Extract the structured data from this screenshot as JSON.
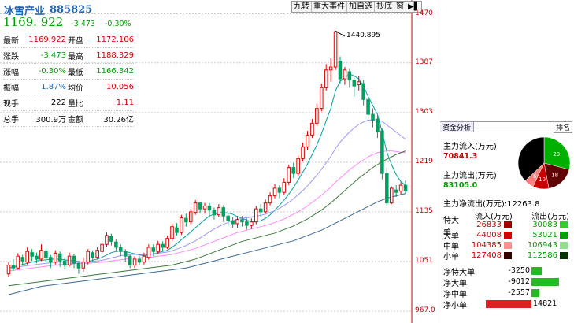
{
  "toolbar": [
    "九转",
    "重大事件",
    "加自选",
    "抄底",
    "窗",
    "▶▌"
  ],
  "y_ticks": [
    "1470",
    "1387",
    "1303",
    "1219",
    "1135",
    "1051",
    "967.0"
  ],
  "max_label": "1440.895",
  "header": {
    "name": "冰雪产业",
    "code": "885825",
    "price": "1169. 922",
    "change": "-3.473",
    "pct": "-0.30%"
  },
  "quote": [
    {
      "k": "最新",
      "v": "1169.922",
      "vc": "r",
      "k2": "开盘",
      "v2": "1172.106",
      "v2c": "r"
    },
    {
      "k": "涨跌",
      "v": "-3.473",
      "vc": "g",
      "k2": "最高",
      "v2": "1188.329",
      "v2c": "r"
    },
    {
      "k": "涨幅",
      "v": "-0.30%",
      "vc": "g",
      "k2": "最低",
      "v2": "1166.342",
      "v2c": "g"
    },
    {
      "k": "振幅",
      "v": "1.87%",
      "vc": "b",
      "k2": "均价",
      "v2": "10.056",
      "v2c": "r"
    },
    {
      "k": "现手",
      "v": "222",
      "vc": "",
      "k2": "量比",
      "v2": "1.11",
      "v2c": "r"
    },
    {
      "k": "总手",
      "v": "300.9万",
      "vc": "",
      "k2": "金额",
      "v2": "30.26亿",
      "v2c": ""
    }
  ],
  "capital": {
    "tab": "资金分析",
    "rank": "排名",
    "inflow_label": "主力流入(万元)",
    "inflow": "70841.3",
    "outflow_label": "主力流出(万元)",
    "outflow": "83105.0",
    "net_label": "主力净流出(万元):",
    "net": "12263.8",
    "pie": [
      {
        "label": "29",
        "value": 29
      },
      {
        "label": "18",
        "value": 18
      },
      {
        "label": "10",
        "value": 10
      },
      {
        "label": "6",
        "value": 6
      }
    ]
  },
  "flow_table": {
    "h_in": "流入(万元)",
    "h_out": "流出(万元)",
    "rows": [
      {
        "k": "特大单",
        "in": "26833",
        "out": "30083",
        "cin": "#a00000",
        "cout": "#33cc33"
      },
      {
        "k": "大单",
        "in": "44008",
        "out": "53021",
        "cin": "#d00000",
        "cout": "#00a000"
      },
      {
        "k": "中单",
        "in": "104385",
        "out": "106943",
        "cin": "#ff9090",
        "cout": "#90e090"
      },
      {
        "k": "小单",
        "in": "127408",
        "out": "112586",
        "cin": "#330000",
        "cout": "#003300"
      }
    ]
  },
  "net_flow": [
    {
      "k": "净特大单",
      "v": "-3250",
      "frac": -0.22
    },
    {
      "k": "净大单",
      "v": "-9012",
      "frac": -0.61
    },
    {
      "k": "净中单",
      "v": "-2557",
      "frac": -0.17
    },
    {
      "k": "净小单",
      "v": "14821",
      "frac": 1.0
    }
  ],
  "chart_data": {
    "type": "candlestick",
    "ylim": [
      967.0,
      1480
    ],
    "y_ticks": [
      1470,
      1387,
      1303,
      1219,
      1135,
      1051,
      967.0
    ],
    "max_annotation": 1440.895,
    "candles": [
      [
        1030,
        1045,
        1025,
        1050
      ],
      [
        1045,
        1040,
        1035,
        1055
      ],
      [
        1040,
        1060,
        1038,
        1065
      ],
      [
        1058,
        1052,
        1045,
        1062
      ],
      [
        1050,
        1068,
        1046,
        1075
      ],
      [
        1066,
        1060,
        1052,
        1072
      ],
      [
        1060,
        1055,
        1048,
        1066
      ],
      [
        1055,
        1070,
        1052,
        1080
      ],
      [
        1068,
        1058,
        1050,
        1072
      ],
      [
        1058,
        1050,
        1040,
        1062
      ],
      [
        1050,
        1065,
        1046,
        1070
      ],
      [
        1064,
        1052,
        1042,
        1068
      ],
      [
        1052,
        1045,
        1038,
        1058
      ],
      [
        1045,
        1060,
        1042,
        1066
      ],
      [
        1060,
        1048,
        1040,
        1064
      ],
      [
        1048,
        1040,
        1030,
        1052
      ],
      [
        1040,
        1050,
        1034,
        1058
      ],
      [
        1050,
        1068,
        1046,
        1072
      ],
      [
        1066,
        1058,
        1050,
        1070
      ],
      [
        1058,
        1070,
        1055,
        1075
      ],
      [
        1068,
        1080,
        1064,
        1086
      ],
      [
        1080,
        1095,
        1076,
        1100
      ],
      [
        1094,
        1085,
        1078,
        1098
      ],
      [
        1084,
        1075,
        1068,
        1088
      ],
      [
        1075,
        1068,
        1060,
        1080
      ],
      [
        1068,
        1060,
        1050,
        1072
      ],
      [
        1060,
        1045,
        1040,
        1064
      ],
      [
        1045,
        1055,
        1040,
        1060
      ],
      [
        1055,
        1050,
        1045,
        1060
      ],
      [
        1050,
        1060,
        1046,
        1066
      ],
      [
        1058,
        1075,
        1054,
        1080
      ],
      [
        1074,
        1068,
        1060,
        1080
      ],
      [
        1068,
        1080,
        1064,
        1086
      ],
      [
        1080,
        1075,
        1068,
        1085
      ],
      [
        1075,
        1090,
        1072,
        1095
      ],
      [
        1090,
        1110,
        1086,
        1115
      ],
      [
        1108,
        1100,
        1095,
        1116
      ],
      [
        1100,
        1125,
        1096,
        1130
      ],
      [
        1124,
        1118,
        1110,
        1132
      ],
      [
        1118,
        1135,
        1114,
        1140
      ],
      [
        1134,
        1150,
        1130,
        1155
      ],
      [
        1150,
        1140,
        1132,
        1152
      ],
      [
        1140,
        1145,
        1132,
        1150
      ],
      [
        1145,
        1138,
        1128,
        1150
      ],
      [
        1138,
        1130,
        1122,
        1142
      ],
      [
        1130,
        1142,
        1126,
        1148
      ],
      [
        1142,
        1128,
        1118,
        1146
      ],
      [
        1128,
        1120,
        1110,
        1132
      ],
      [
        1120,
        1115,
        1108,
        1126
      ],
      [
        1115,
        1122,
        1108,
        1128
      ],
      [
        1122,
        1118,
        1110,
        1128
      ],
      [
        1118,
        1112,
        1105,
        1124
      ],
      [
        1112,
        1118,
        1106,
        1124
      ],
      [
        1118,
        1140,
        1114,
        1145
      ],
      [
        1140,
        1135,
        1126,
        1148
      ],
      [
        1135,
        1150,
        1132,
        1156
      ],
      [
        1150,
        1162,
        1146,
        1168
      ],
      [
        1162,
        1175,
        1158,
        1182
      ],
      [
        1175,
        1168,
        1158,
        1180
      ],
      [
        1168,
        1185,
        1164,
        1192
      ],
      [
        1185,
        1210,
        1180,
        1215
      ],
      [
        1210,
        1200,
        1192,
        1218
      ],
      [
        1200,
        1225,
        1196,
        1230
      ],
      [
        1225,
        1245,
        1220,
        1252
      ],
      [
        1245,
        1265,
        1240,
        1272
      ],
      [
        1265,
        1285,
        1260,
        1292
      ],
      [
        1285,
        1310,
        1280,
        1318
      ],
      [
        1310,
        1345,
        1305,
        1352
      ],
      [
        1345,
        1375,
        1340,
        1385
      ],
      [
        1375,
        1380,
        1355,
        1395
      ],
      [
        1380,
        1440,
        1375,
        1441
      ],
      [
        1390,
        1360,
        1352,
        1398
      ],
      [
        1360,
        1375,
        1350,
        1380
      ],
      [
        1372,
        1358,
        1345,
        1378
      ],
      [
        1358,
        1348,
        1330,
        1362
      ],
      [
        1350,
        1355,
        1340,
        1365
      ],
      [
        1352,
        1325,
        1315,
        1358
      ],
      [
        1325,
        1300,
        1290,
        1330
      ],
      [
        1300,
        1290,
        1278,
        1310
      ],
      [
        1292,
        1270,
        1260,
        1298
      ],
      [
        1272,
        1200,
        1190,
        1276
      ],
      [
        1200,
        1150,
        1145,
        1210
      ],
      [
        1150,
        1175,
        1148,
        1178
      ],
      [
        1172,
        1168,
        1160,
        1180
      ],
      [
        1170,
        1180,
        1164,
        1185
      ],
      [
        1180,
        1170,
        1166,
        1188
      ]
    ],
    "series": [
      {
        "name": "",
        "color": "#00a0a0",
        "values": [
          1040,
          1042,
          1044,
          1046,
          1048,
          1050,
          1052,
          1053,
          1054,
          1055,
          1055,
          1055,
          1054,
          1053,
          1052,
          1051,
          1050,
          1051,
          1053,
          1055,
          1058,
          1062,
          1066,
          1068,
          1069,
          1068,
          1066,
          1064,
          1062,
          1061,
          1062,
          1064,
          1066,
          1068,
          1070,
          1075,
          1081,
          1088,
          1094,
          1101,
          1108,
          1115,
          1122,
          1128,
          1131,
          1133,
          1134,
          1133,
          1131,
          1127,
          1124,
          1121,
          1118,
          1118,
          1120,
          1124,
          1130,
          1138,
          1146,
          1155,
          1165,
          1176,
          1189,
          1202,
          1216,
          1232,
          1248,
          1267,
          1289,
          1310,
          1340,
          1356,
          1362,
          1368,
          1365,
          1360,
          1348,
          1330,
          1315,
          1300,
          1270,
          1236,
          1215,
          1198,
          1186,
          1180
        ]
      },
      {
        "name": "",
        "color": "#9999ff",
        "values": [
          1040,
          1041,
          1042,
          1043,
          1044,
          1045,
          1046,
          1047,
          1048,
          1049,
          1050,
          1050,
          1050,
          1050,
          1050,
          1050,
          1050,
          1050,
          1051,
          1052,
          1053,
          1055,
          1057,
          1059,
          1061,
          1062,
          1063,
          1063,
          1063,
          1063,
          1063,
          1064,
          1065,
          1066,
          1067,
          1069,
          1072,
          1075,
          1078,
          1082,
          1086,
          1091,
          1096,
          1101,
          1106,
          1110,
          1114,
          1117,
          1120,
          1122,
          1124,
          1125,
          1126,
          1128,
          1129,
          1131,
          1134,
          1137,
          1141,
          1146,
          1151,
          1157,
          1164,
          1171,
          1179,
          1188,
          1197,
          1207,
          1218,
          1229,
          1242,
          1253,
          1262,
          1270,
          1277,
          1283,
          1287,
          1290,
          1291,
          1291,
          1288,
          1282,
          1276,
          1270,
          1264,
          1258
        ]
      },
      {
        "name": "",
        "color": "#ff88ff",
        "values": [
          1035,
          1036,
          1037,
          1038,
          1039,
          1040,
          1041,
          1042,
          1043,
          1044,
          1045,
          1046,
          1046,
          1047,
          1047,
          1048,
          1048,
          1048,
          1049,
          1049,
          1050,
          1051,
          1052,
          1053,
          1054,
          1055,
          1056,
          1057,
          1057,
          1058,
          1058,
          1059,
          1060,
          1061,
          1062,
          1063,
          1065,
          1067,
          1069,
          1071,
          1073,
          1076,
          1079,
          1082,
          1085,
          1088,
          1091,
          1094,
          1097,
          1100,
          1102,
          1104,
          1106,
          1108,
          1110,
          1112,
          1114,
          1117,
          1120,
          1123,
          1127,
          1131,
          1135,
          1140,
          1145,
          1151,
          1157,
          1163,
          1170,
          1177,
          1185,
          1192,
          1199,
          1206,
          1212,
          1218,
          1223,
          1228,
          1232,
          1235,
          1237,
          1238,
          1238,
          1237,
          1236,
          1235
        ]
      },
      {
        "name": "",
        "color": "#3a7a3a",
        "values": [
          1010,
          1011,
          1012,
          1013,
          1014,
          1015,
          1016,
          1017,
          1018,
          1019,
          1020,
          1021,
          1022,
          1023,
          1024,
          1025,
          1026,
          1027,
          1028,
          1029,
          1030,
          1031,
          1032,
          1033,
          1034,
          1035,
          1036,
          1037,
          1038,
          1039,
          1040,
          1041,
          1042,
          1043,
          1044,
          1045,
          1047,
          1049,
          1051,
          1053,
          1055,
          1058,
          1061,
          1064,
          1067,
          1070,
          1073,
          1076,
          1079,
          1082,
          1085,
          1087,
          1089,
          1091,
          1093,
          1095,
          1097,
          1099,
          1102,
          1105,
          1108,
          1111,
          1115,
          1119,
          1123,
          1128,
          1133,
          1138,
          1144,
          1150,
          1157,
          1164,
          1171,
          1178,
          1185,
          1192,
          1198,
          1204,
          1210,
          1215,
          1220,
          1224,
          1228,
          1232,
          1235,
          1238
        ]
      },
      {
        "name": "",
        "color": "#3a6a9a",
        "values": [
          995,
          997,
          999,
          1001,
          1003,
          1005,
          1007,
          1009,
          1010,
          1011,
          1012,
          1013,
          1014,
          1015,
          1016,
          1017,
          1018,
          1019,
          1020,
          1021,
          1022,
          1023,
          1024,
          1025,
          1026,
          1027,
          1028,
          1029,
          1030,
          1031,
          1032,
          1033,
          1034,
          1035,
          1036,
          1037,
          1038,
          1039,
          1040,
          1042,
          1044,
          1046,
          1048,
          1050,
          1052,
          1054,
          1056,
          1058,
          1060,
          1062,
          1064,
          1066,
          1068,
          1070,
          1072,
          1074,
          1076,
          1078,
          1080,
          1082,
          1084,
          1086,
          1089,
          1092,
          1095,
          1098,
          1101,
          1104,
          1108,
          1112,
          1116,
          1120,
          1124,
          1128,
          1132,
          1136,
          1140,
          1144,
          1148,
          1152,
          1155,
          1158,
          1160,
          1162,
          1164,
          1166
        ]
      }
    ]
  }
}
